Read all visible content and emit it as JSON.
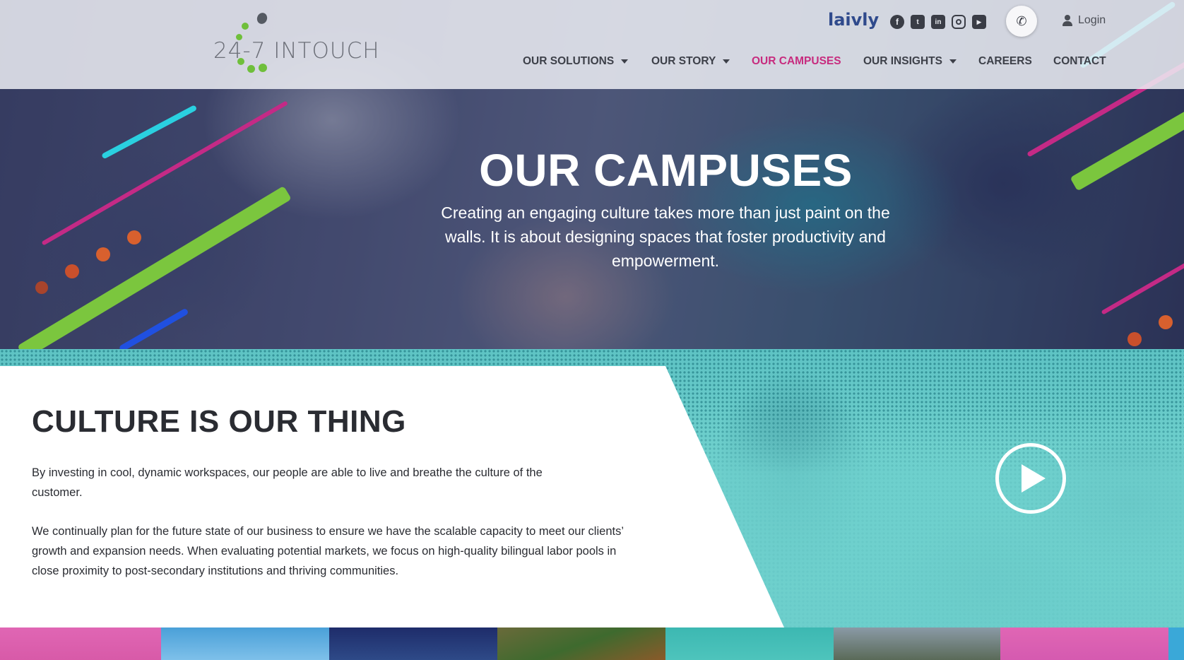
{
  "brand": {
    "logo_text": "24-7 INTOUCH",
    "partner_logo": "laivly",
    "accent_color": "#c72b7e",
    "logo_green": "#6fbf3b"
  },
  "utility_bar": {
    "social_icons": [
      "facebook-icon",
      "twitter-icon",
      "linkedin-icon",
      "instagram-icon",
      "youtube-icon"
    ],
    "phone_icon": "phone-icon",
    "login_label": "Login"
  },
  "nav": {
    "items": [
      {
        "label": "OUR SOLUTIONS",
        "has_dropdown": true,
        "active": false
      },
      {
        "label": "OUR STORY",
        "has_dropdown": true,
        "active": false
      },
      {
        "label": "OUR CAMPUSES",
        "has_dropdown": false,
        "active": true
      },
      {
        "label": "OUR INSIGHTS",
        "has_dropdown": true,
        "active": false
      },
      {
        "label": "CAREERS",
        "has_dropdown": false,
        "active": false
      },
      {
        "label": "CONTACT",
        "has_dropdown": false,
        "active": false
      }
    ]
  },
  "hero": {
    "title": "OUR CAMPUSES",
    "subtitle": "Creating an engaging culture takes more than just paint on the walls. It is about designing spaces that foster productivity and empowerment."
  },
  "culture": {
    "title": "CULTURE IS OUR THING",
    "paragraphs": [
      "By investing in cool, dynamic workspaces, our people are able to live and breathe the culture of the customer.",
      "We continually plan for the future state of our business to ensure we have the scalable capacity to meet our clients’ growth and expansion needs. When evaluating potential markets, we focus on high-quality bilingual labor pools in close proximity to post-secondary institutions and thriving communities."
    ]
  },
  "video": {
    "play_icon": "play-icon"
  }
}
